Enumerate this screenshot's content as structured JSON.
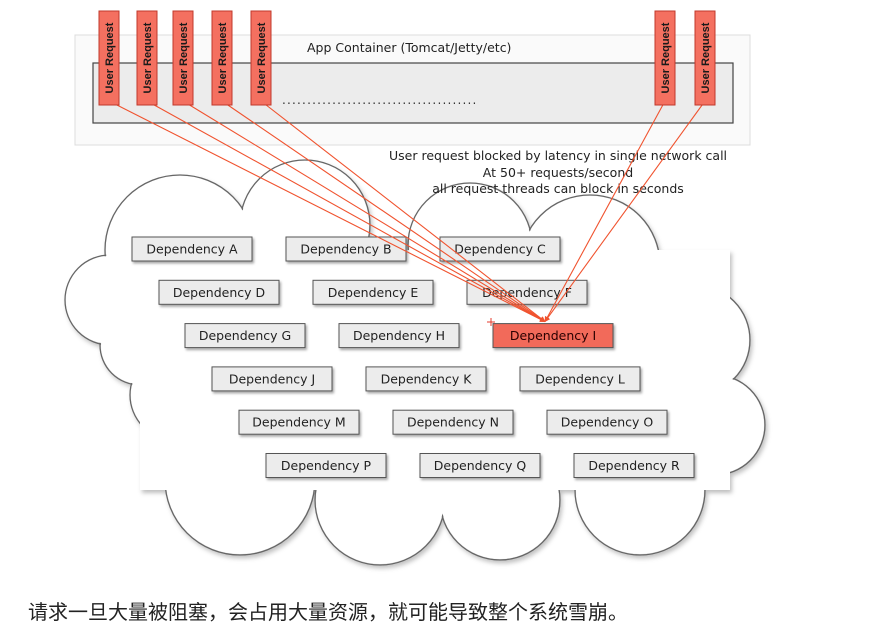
{
  "container": {
    "title": "App Container (Tomcat/Jetty/etc)",
    "dots": "......................................."
  },
  "user_request_label": "User Request",
  "notes": {
    "line1": "User request blocked by latency in single network call",
    "line2": "At 50+ requests/second",
    "line3": "all request threads can block in seconds"
  },
  "dependencies": [
    {
      "label": "Dependency A",
      "blocked": false
    },
    {
      "label": "Dependency B",
      "blocked": false
    },
    {
      "label": "Dependency C",
      "blocked": false
    },
    {
      "label": "Dependency D",
      "blocked": false
    },
    {
      "label": "Dependency E",
      "blocked": false
    },
    {
      "label": "Dependency F",
      "blocked": false
    },
    {
      "label": "Dependency G",
      "blocked": false
    },
    {
      "label": "Dependency H",
      "blocked": false
    },
    {
      "label": "Dependency I",
      "blocked": true
    },
    {
      "label": "Dependency J",
      "blocked": false
    },
    {
      "label": "Dependency K",
      "blocked": false
    },
    {
      "label": "Dependency L",
      "blocked": false
    },
    {
      "label": "Dependency M",
      "blocked": false
    },
    {
      "label": "Dependency N",
      "blocked": false
    },
    {
      "label": "Dependency O",
      "blocked": false
    },
    {
      "label": "Dependency P",
      "blocked": false
    },
    {
      "label": "Dependency Q",
      "blocked": false
    },
    {
      "label": "Dependency R",
      "blocked": false
    }
  ],
  "caption": "请求一旦大量被阻塞，会占用大量资源，就可能导致整个系统雪崩。",
  "colors": {
    "request_fill": "#f47060",
    "request_stroke": "#c0392b",
    "arrow": "#f0532f",
    "box_fill": "#ececec",
    "box_stroke": "#555555",
    "blocked_fill": "#f26a5a"
  }
}
